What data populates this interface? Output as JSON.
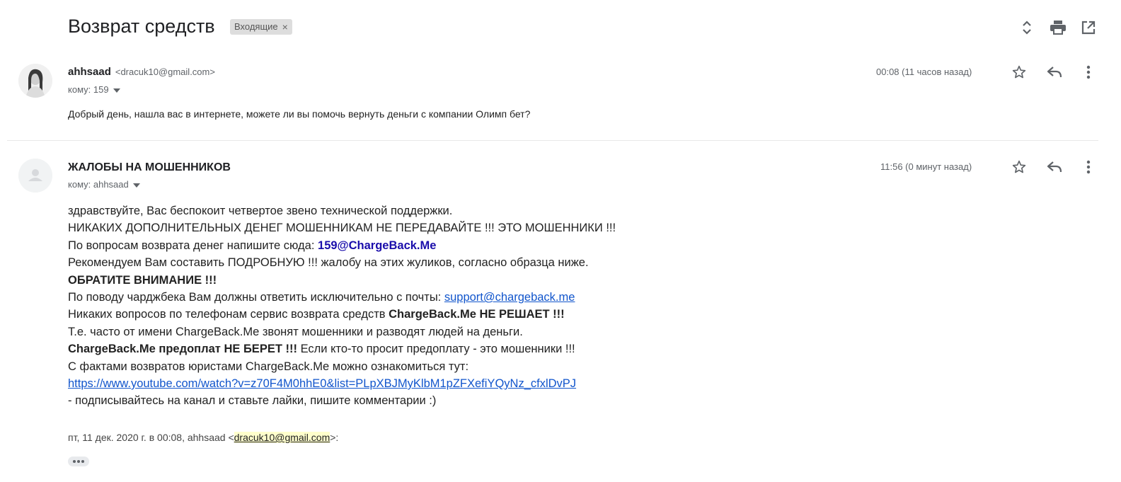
{
  "thread": {
    "subject": "Возврат средств",
    "label": "Входящие",
    "label_remove": "×"
  },
  "toolbar": {
    "icons": [
      "expand-collapse-icon",
      "print-icon",
      "open-in-new-window-icon"
    ]
  },
  "messages": [
    {
      "sender_name": "ahhsaad",
      "sender_email": "<dracuk10@gmail.com>",
      "to": "кому: 159",
      "time": "00:08 (11 часов назад)",
      "body": "Добрый день, нашла вас  в интернете, можете ли вы помочь вернуть деньги с компании Олимп бет?"
    },
    {
      "sender_name": "ЖАЛОБЫ НА МОШЕННИКОВ",
      "to": "кому: ahhsaad",
      "time": "11:56 (0 минут назад)",
      "lines": {
        "l1": "здравствуйте, Вас беспокоит четвертое звено технической поддержки.",
        "l2": "НИКАКИХ ДОПОЛНИТЕЛЬНЫХ ДЕНЕГ МОШЕННИКАМ НЕ ПЕРЕДАВАЙТЕ !!! ЭТО МОШЕННИКИ !!!",
        "l3_text": "По вопросам возврата денег напишите сюда: ",
        "l3_email": "159@ChargeBack.Me",
        "l4": "Рекомендуем Вам составить ПОДРОБНУЮ !!! жалобу на этих жуликов, согласно образца ниже.",
        "l5": "ОБРАТИТЕ ВНИМАНИЕ !!!",
        "l6_text": "По поводу чарджбека Вам должны ответить исключительно с почты: ",
        "l6_link": "support@chargeback.me",
        "l7_text": "Никаких вопросов по телефонам сервис возврата средств ",
        "l7_bold": "ChargeBack.Me НЕ РЕШАЕТ !!!",
        "l8": "Т.е. часто от имени ChargeBack.Me звонят мошенники и разводят людей на деньги.",
        "l9_bold": "ChargeBack.Me предоплат НЕ БЕРЕТ !!!",
        "l9_text": " Если кто-то просит предоплату - это мошенники !!!",
        "l10": "С фактами возвратов юристами ChargeBack.Me можно ознакомиться тут:",
        "l11_link": "https://www.youtube.com/watch?v=z70F4M0hhE0&list=PLpXBJMyKlbM1pZFXefiYQyNz_cfxlDvPJ",
        "l12": " - подписывайтесь на канал и ставьте лайки, пишите комментарии :)"
      },
      "quote_prefix": "пт, 11 дек. 2020 г. в 00:08, ahhsaad <",
      "quote_email": "dracuk10@gmail.com",
      "quote_suffix": ">:"
    }
  ],
  "colors": {
    "link": "#1155cc",
    "email_bold": "#1a0dab",
    "chip_bg": "#dddddd",
    "highlight": "#ffffcc"
  }
}
